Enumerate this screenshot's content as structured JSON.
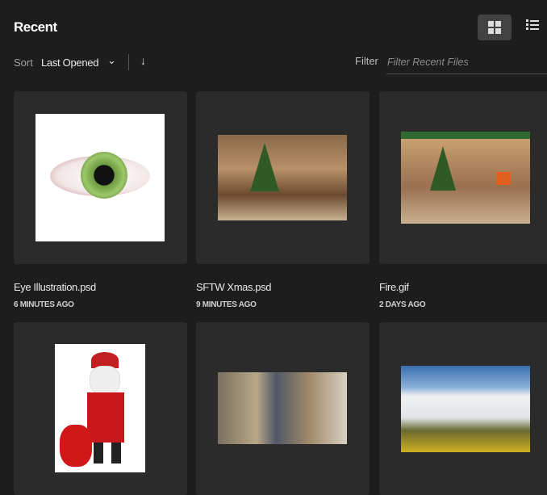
{
  "header": {
    "title": "Recent"
  },
  "view": {
    "grid_icon": "grid-view-icon",
    "list_icon": "list-view-icon"
  },
  "sort": {
    "label": "Sort",
    "value": "Last Opened",
    "chevron": "⌄",
    "direction": "↓"
  },
  "filter": {
    "label": "Filter",
    "placeholder": "Filter Recent Files"
  },
  "files": [
    {
      "name": "Eye Illustration.psd",
      "time": "6 MINUTES AGO"
    },
    {
      "name": "SFTW Xmas.psd",
      "time": "9 MINUTES AGO"
    },
    {
      "name": "Fire.gif",
      "time": "2 DAYS AGO"
    },
    {
      "name": "",
      "time": ""
    },
    {
      "name": "",
      "time": ""
    },
    {
      "name": "",
      "time": ""
    }
  ]
}
